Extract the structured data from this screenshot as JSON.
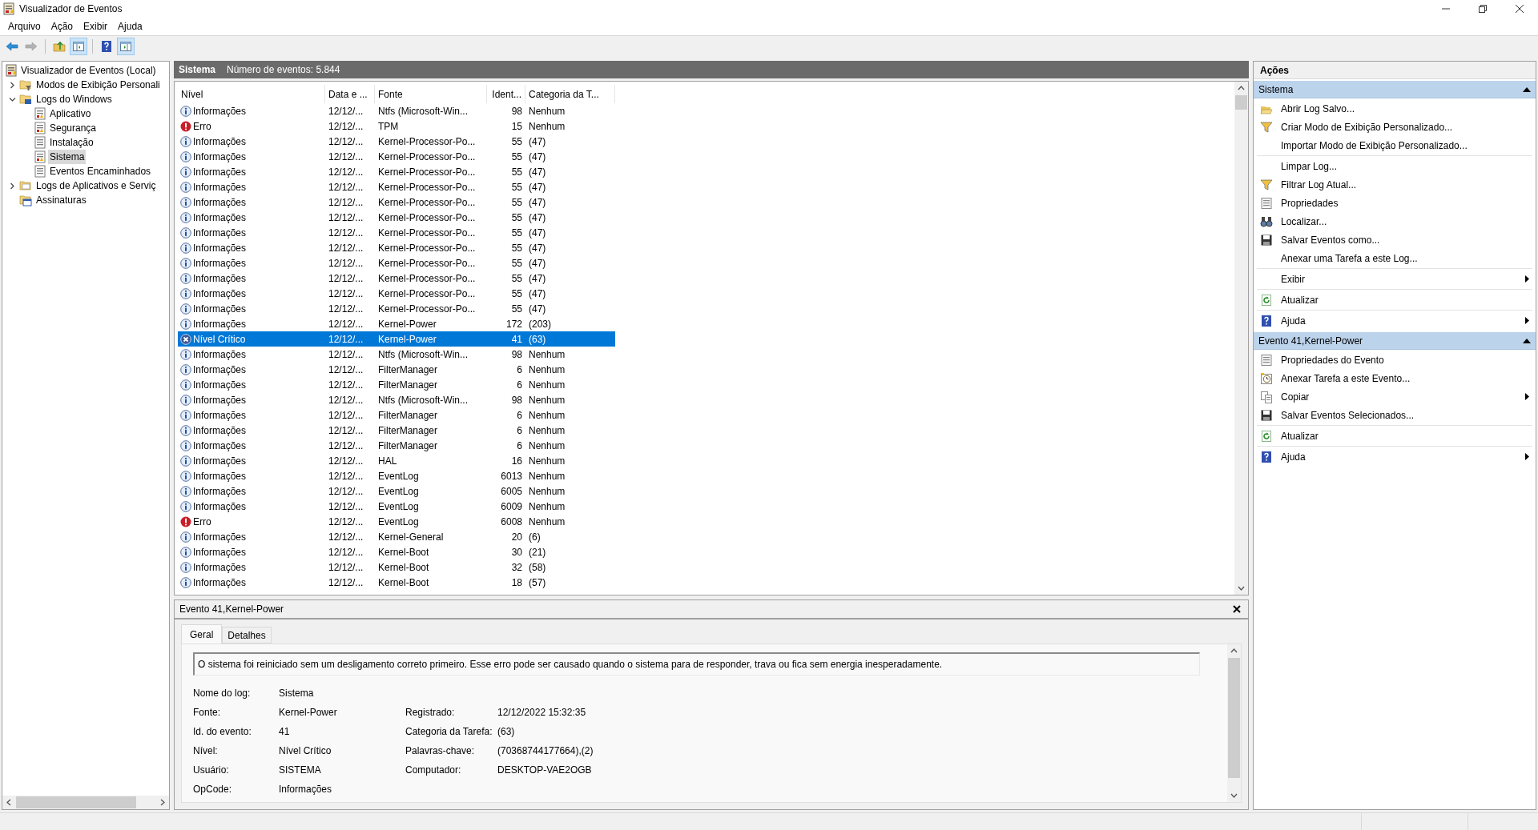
{
  "window": {
    "title": "Visualizador de Eventos"
  },
  "menu": [
    "Arquivo",
    "Ação",
    "Exibir",
    "Ajuda"
  ],
  "toolbar": [
    {
      "kind": "back",
      "on": false,
      "disabled": false
    },
    {
      "kind": "forward",
      "on": false,
      "disabled": true
    },
    {
      "kind": "up",
      "on": false,
      "disabled": false
    },
    {
      "kind": "tree_pane",
      "on": true,
      "disabled": false
    },
    {
      "kind": "help",
      "on": false,
      "disabled": false
    },
    {
      "kind": "action_pane",
      "on": true,
      "disabled": false
    }
  ],
  "tree": [
    {
      "label": "Visualizador de Eventos (Local)",
      "kind": "root",
      "selected": false,
      "children": [
        {
          "label": "Modos de Exibição Personali",
          "kind": "custom_views",
          "expanded": false,
          "selected": false
        },
        {
          "label": "Logs do Windows",
          "kind": "windows_logs",
          "expanded": true,
          "selected": false,
          "children": [
            {
              "label": "Aplicativo",
              "kind": "log",
              "selected": false
            },
            {
              "label": "Segurança",
              "kind": "log",
              "selected": false
            },
            {
              "label": "Instalação",
              "kind": "plain_log",
              "selected": false
            },
            {
              "label": "Sistema",
              "kind": "log",
              "selected": true
            },
            {
              "label": "Eventos Encaminhados",
              "kind": "plain_log",
              "selected": false
            }
          ]
        },
        {
          "label": "Logs de Aplicativos e Serviç",
          "kind": "folder",
          "expanded": false,
          "selected": false
        },
        {
          "label": "Assinaturas",
          "kind": "subscriptions",
          "selected": false
        }
      ]
    }
  ],
  "log_header": {
    "title": "Sistema",
    "count": "Número de eventos: 5.844"
  },
  "table": {
    "columns": [
      "Nível",
      "Data e ...",
      "Fonte",
      "Ident...",
      "Categoria da T..."
    ],
    "rows": [
      {
        "kind": "info",
        "level_text": "Informações",
        "date": "12/12/...",
        "source": "Ntfs (Microsoft-Win...",
        "id": "98",
        "category": "Nenhum",
        "selected": false
      },
      {
        "kind": "error",
        "level_text": "Erro",
        "date": "12/12/...",
        "source": "TPM",
        "id": "15",
        "category": "Nenhum",
        "selected": false
      },
      {
        "kind": "info",
        "level_text": "Informações",
        "date": "12/12/...",
        "source": "Kernel-Processor-Po...",
        "id": "55",
        "category": "(47)",
        "selected": false
      },
      {
        "kind": "info",
        "level_text": "Informações",
        "date": "12/12/...",
        "source": "Kernel-Processor-Po...",
        "id": "55",
        "category": "(47)",
        "selected": false
      },
      {
        "kind": "info",
        "level_text": "Informações",
        "date": "12/12/...",
        "source": "Kernel-Processor-Po...",
        "id": "55",
        "category": "(47)",
        "selected": false
      },
      {
        "kind": "info",
        "level_text": "Informações",
        "date": "12/12/...",
        "source": "Kernel-Processor-Po...",
        "id": "55",
        "category": "(47)",
        "selected": false
      },
      {
        "kind": "info",
        "level_text": "Informações",
        "date": "12/12/...",
        "source": "Kernel-Processor-Po...",
        "id": "55",
        "category": "(47)",
        "selected": false
      },
      {
        "kind": "info",
        "level_text": "Informações",
        "date": "12/12/...",
        "source": "Kernel-Processor-Po...",
        "id": "55",
        "category": "(47)",
        "selected": false
      },
      {
        "kind": "info",
        "level_text": "Informações",
        "date": "12/12/...",
        "source": "Kernel-Processor-Po...",
        "id": "55",
        "category": "(47)",
        "selected": false
      },
      {
        "kind": "info",
        "level_text": "Informações",
        "date": "12/12/...",
        "source": "Kernel-Processor-Po...",
        "id": "55",
        "category": "(47)",
        "selected": false
      },
      {
        "kind": "info",
        "level_text": "Informações",
        "date": "12/12/...",
        "source": "Kernel-Processor-Po...",
        "id": "55",
        "category": "(47)",
        "selected": false
      },
      {
        "kind": "info",
        "level_text": "Informações",
        "date": "12/12/...",
        "source": "Kernel-Processor-Po...",
        "id": "55",
        "category": "(47)",
        "selected": false
      },
      {
        "kind": "info",
        "level_text": "Informações",
        "date": "12/12/...",
        "source": "Kernel-Processor-Po...",
        "id": "55",
        "category": "(47)",
        "selected": false
      },
      {
        "kind": "info",
        "level_text": "Informações",
        "date": "12/12/...",
        "source": "Kernel-Processor-Po...",
        "id": "55",
        "category": "(47)",
        "selected": false
      },
      {
        "kind": "info",
        "level_text": "Informações",
        "date": "12/12/...",
        "source": "Kernel-Power",
        "id": "172",
        "category": "(203)",
        "selected": false
      },
      {
        "kind": "critical",
        "level_text": "Nível Crítico",
        "date": "12/12/...",
        "source": "Kernel-Power",
        "id": "41",
        "category": "(63)",
        "selected": true
      },
      {
        "kind": "info",
        "level_text": "Informações",
        "date": "12/12/...",
        "source": "Ntfs (Microsoft-Win...",
        "id": "98",
        "category": "Nenhum",
        "selected": false
      },
      {
        "kind": "info",
        "level_text": "Informações",
        "date": "12/12/...",
        "source": "FilterManager",
        "id": "6",
        "category": "Nenhum",
        "selected": false
      },
      {
        "kind": "info",
        "level_text": "Informações",
        "date": "12/12/...",
        "source": "FilterManager",
        "id": "6",
        "category": "Nenhum",
        "selected": false
      },
      {
        "kind": "info",
        "level_text": "Informações",
        "date": "12/12/...",
        "source": "Ntfs (Microsoft-Win...",
        "id": "98",
        "category": "Nenhum",
        "selected": false
      },
      {
        "kind": "info",
        "level_text": "Informações",
        "date": "12/12/...",
        "source": "FilterManager",
        "id": "6",
        "category": "Nenhum",
        "selected": false
      },
      {
        "kind": "info",
        "level_text": "Informações",
        "date": "12/12/...",
        "source": "FilterManager",
        "id": "6",
        "category": "Nenhum",
        "selected": false
      },
      {
        "kind": "info",
        "level_text": "Informações",
        "date": "12/12/...",
        "source": "FilterManager",
        "id": "6",
        "category": "Nenhum",
        "selected": false
      },
      {
        "kind": "info",
        "level_text": "Informações",
        "date": "12/12/...",
        "source": "HAL",
        "id": "16",
        "category": "Nenhum",
        "selected": false
      },
      {
        "kind": "info",
        "level_text": "Informações",
        "date": "12/12/...",
        "source": "EventLog",
        "id": "6013",
        "category": "Nenhum",
        "selected": false
      },
      {
        "kind": "info",
        "level_text": "Informações",
        "date": "12/12/...",
        "source": "EventLog",
        "id": "6005",
        "category": "Nenhum",
        "selected": false
      },
      {
        "kind": "info",
        "level_text": "Informações",
        "date": "12/12/...",
        "source": "EventLog",
        "id": "6009",
        "category": "Nenhum",
        "selected": false
      },
      {
        "kind": "error",
        "level_text": "Erro",
        "date": "12/12/...",
        "source": "EventLog",
        "id": "6008",
        "category": "Nenhum",
        "selected": false
      },
      {
        "kind": "info",
        "level_text": "Informações",
        "date": "12/12/...",
        "source": "Kernel-General",
        "id": "20",
        "category": "(6)",
        "selected": false
      },
      {
        "kind": "info",
        "level_text": "Informações",
        "date": "12/12/...",
        "source": "Kernel-Boot",
        "id": "30",
        "category": "(21)",
        "selected": false
      },
      {
        "kind": "info",
        "level_text": "Informações",
        "date": "12/12/...",
        "source": "Kernel-Boot",
        "id": "32",
        "category": "(58)",
        "selected": false
      },
      {
        "kind": "info",
        "level_text": "Informações",
        "date": "12/12/...",
        "source": "Kernel-Boot",
        "id": "18",
        "category": "(57)",
        "selected": false
      }
    ]
  },
  "detail": {
    "title": "Evento 41,Kernel-Power",
    "tabs": [
      {
        "label": "Geral",
        "selected": true
      },
      {
        "label": "Detalhes",
        "selected": false
      }
    ],
    "message": "O sistema foi reiniciado sem um desligamento correto primeiro. Esse erro pode ser causado quando o sistema para de responder, trava ou fica sem energia inesperadamente.",
    "left": [
      {
        "label": "Nome do log:",
        "value": "Sistema"
      },
      {
        "label": "Fonte:",
        "value": "Kernel-Power"
      },
      {
        "label": "Id. do evento:",
        "value": "41"
      },
      {
        "label": "Nível:",
        "value": "Nível Crítico"
      },
      {
        "label": "Usuário:",
        "value": "SISTEMA"
      },
      {
        "label": "OpCode:",
        "value": "Informações"
      }
    ],
    "right": [
      {
        "label": "Registrado:",
        "value": "12/12/2022 15:32:35"
      },
      {
        "label": "Categoria da Tarefa:",
        "value": "(63)"
      },
      {
        "label": "Palavras-chave:",
        "value": "(70368744177664),(2)"
      },
      {
        "label": "Computador:",
        "value": "DESKTOP-VAE2OGB"
      }
    ]
  },
  "actions": {
    "title": "Ações",
    "sections": [
      {
        "title": "Sistema",
        "expanded": true,
        "groups": [
          [
            {
              "label": "Abrir Log Salvo...",
              "kind": "open",
              "submenu": false
            },
            {
              "label": "Criar Modo de Exibição Personalizado...",
              "kind": "filter",
              "submenu": false
            },
            {
              "label": "Importar Modo de Exibição Personalizado...",
              "kind": "none",
              "submenu": false
            }
          ],
          [
            {
              "label": "Limpar Log...",
              "kind": "none",
              "submenu": false
            },
            {
              "label": "Filtrar Log Atual...",
              "kind": "filter",
              "submenu": false
            },
            {
              "label": "Propriedades",
              "kind": "properties",
              "submenu": false
            },
            {
              "label": "Localizar...",
              "kind": "find",
              "submenu": false
            },
            {
              "label": "Salvar Eventos como...",
              "kind": "save",
              "submenu": false
            },
            {
              "label": "Anexar uma Tarefa a este Log...",
              "kind": "none",
              "submenu": false
            }
          ],
          [
            {
              "label": "Exibir",
              "kind": "none",
              "submenu": true
            }
          ],
          [
            {
              "label": "Atualizar",
              "kind": "refresh",
              "submenu": false
            }
          ],
          [
            {
              "label": "Ajuda",
              "kind": "help",
              "submenu": true
            }
          ]
        ]
      },
      {
        "title": "Evento 41,Kernel-Power",
        "expanded": true,
        "groups": [
          [
            {
              "label": "Propriedades do Evento",
              "kind": "properties",
              "submenu": false
            },
            {
              "label": "Anexar Tarefa a este Evento...",
              "kind": "task",
              "submenu": false
            },
            {
              "label": "Copiar",
              "kind": "copy",
              "submenu": true
            },
            {
              "label": "Salvar Eventos Selecionados...",
              "kind": "save",
              "submenu": false
            }
          ],
          [
            {
              "label": "Atualizar",
              "kind": "refresh",
              "submenu": false
            }
          ],
          [
            {
              "label": "Ajuda",
              "kind": "help",
              "submenu": true
            }
          ]
        ]
      }
    ]
  }
}
